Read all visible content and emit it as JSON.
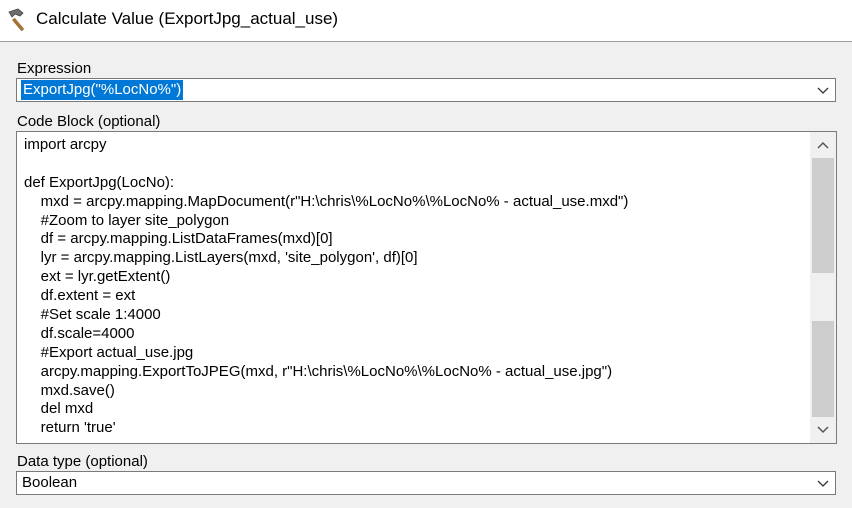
{
  "window": {
    "title": "Calculate Value (ExportJpg_actual_use)"
  },
  "expression": {
    "label": "Expression",
    "value": "ExportJpg(\"%LocNo%\")"
  },
  "code_block": {
    "label": "Code Block (optional)",
    "lines": [
      "import arcpy",
      "",
      "def ExportJpg(LocNo):",
      "    mxd = arcpy.mapping.MapDocument(r\"H:\\chris\\%LocNo%\\%LocNo% - actual_use.mxd\")",
      "    #Zoom to layer site_polygon",
      "    df = arcpy.mapping.ListDataFrames(mxd)[0]",
      "    lyr = arcpy.mapping.ListLayers(mxd, 'site_polygon', df)[0]",
      "    ext = lyr.getExtent()",
      "    df.extent = ext",
      "    #Set scale 1:4000",
      "    df.scale=4000",
      "    #Export actual_use.jpg",
      "    arcpy.mapping.ExportToJPEG(mxd, r\"H:\\chris\\%LocNo%\\%LocNo% - actual_use.jpg\")",
      "    mxd.save()",
      "    del mxd",
      "    return 'true'"
    ]
  },
  "data_type": {
    "label": "Data type (optional)",
    "value": "Boolean"
  },
  "icons": {
    "window": "hammer-icon",
    "dropdown": "chevron-down-icon",
    "scroll_up": "chevron-up-icon",
    "scroll_down": "chevron-down-icon"
  },
  "colors": {
    "selection": "#0078d7",
    "panel_background": "#f0f0f0"
  }
}
